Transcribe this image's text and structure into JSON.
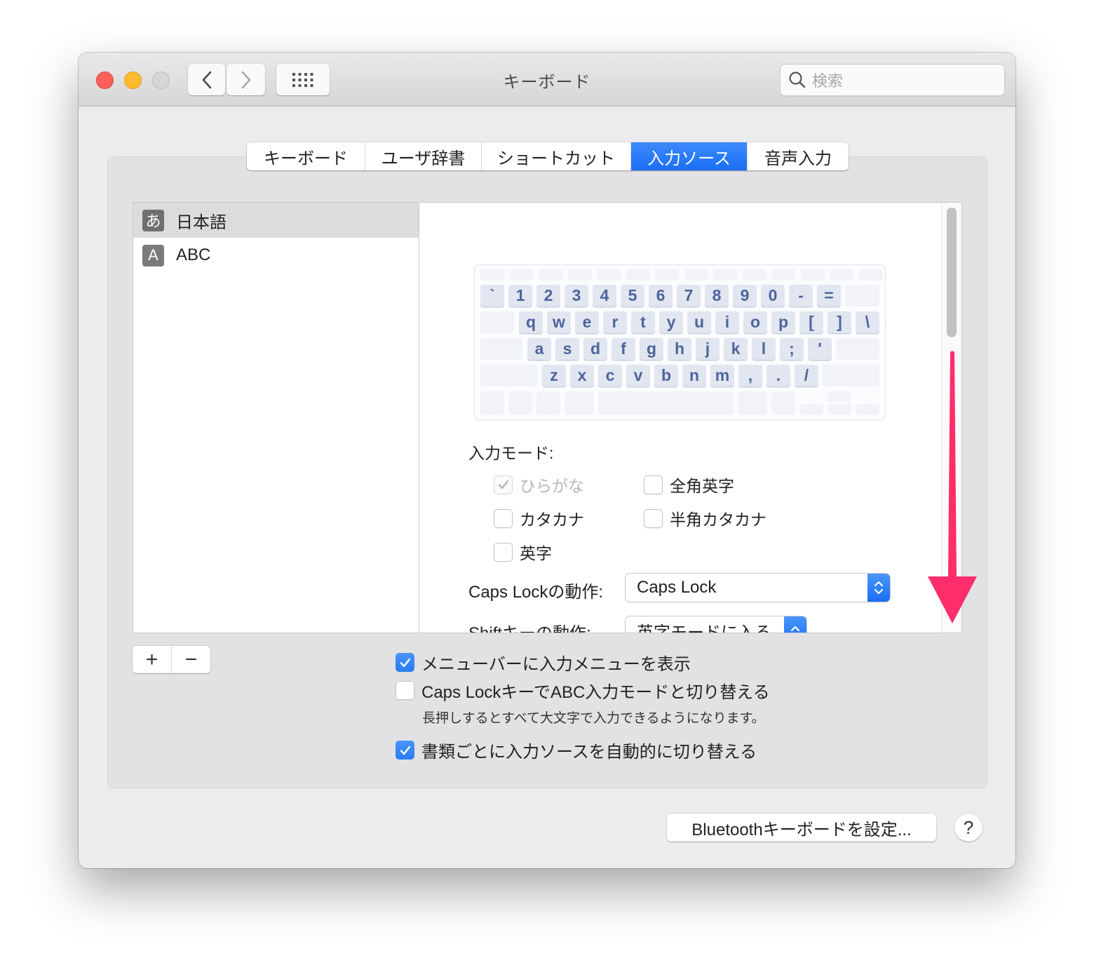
{
  "window": {
    "title": "キーボード",
    "search_placeholder": "検索",
    "traffic_lights": [
      "close",
      "minimize",
      "zoom-disabled"
    ]
  },
  "toolbar": {
    "back_icon": "chevron-left-icon",
    "forward_icon": "chevron-right-icon",
    "show_all_icon": "grid-icon"
  },
  "tabs": [
    {
      "label": "キーボード",
      "active": false
    },
    {
      "label": "ユーザ辞書",
      "active": false
    },
    {
      "label": "ショートカット",
      "active": false
    },
    {
      "label": "入力ソース",
      "active": true
    },
    {
      "label": "音声入力",
      "active": false
    }
  ],
  "sources": [
    {
      "icon_glyph": "あ",
      "label": "日本語",
      "selected": true
    },
    {
      "icon_glyph": "A",
      "label": "ABC",
      "selected": false
    }
  ],
  "keyboard_layout": {
    "row1": [
      "`",
      "1",
      "2",
      "3",
      "4",
      "5",
      "6",
      "7",
      "8",
      "9",
      "0",
      "-",
      "="
    ],
    "row2": [
      "q",
      "w",
      "e",
      "r",
      "t",
      "y",
      "u",
      "i",
      "o",
      "p",
      "[",
      "]",
      "\\"
    ],
    "row3": [
      "a",
      "s",
      "d",
      "f",
      "g",
      "h",
      "j",
      "k",
      "l",
      ";",
      "'"
    ],
    "row4": [
      "z",
      "x",
      "c",
      "v",
      "b",
      "n",
      "m",
      ",",
      ".",
      "/"
    ]
  },
  "input_modes": {
    "label": "入力モード:",
    "options": [
      {
        "label": "ひらがな",
        "checked": true,
        "disabled": true
      },
      {
        "label": "全角英字",
        "checked": false,
        "disabled": false
      },
      {
        "label": "カタカナ",
        "checked": false,
        "disabled": false
      },
      {
        "label": "半角カタカナ",
        "checked": false,
        "disabled": false
      },
      {
        "label": "英字",
        "checked": false,
        "disabled": false
      }
    ]
  },
  "caps_lock_action": {
    "label": "Caps Lockの動作:",
    "value": "Caps Lock"
  },
  "shift_action": {
    "label": "Shiftキーの動作:",
    "value": "英字モードに入る"
  },
  "list_controls": {
    "add_label": "+",
    "remove_label": "−"
  },
  "options": [
    {
      "label": "メニューバーに入力メニューを表示",
      "checked": true
    },
    {
      "label": "Caps LockキーでABC入力モードと切り替える",
      "checked": false,
      "note": "長押しするとすべて大文字で入力できるようになります。"
    },
    {
      "label": "書類ごとに入力ソースを自動的に切り替える",
      "checked": true
    }
  ],
  "footer": {
    "bluetooth_button": "Bluetoothキーボードを設定...",
    "help_label": "?"
  },
  "colors": {
    "accent": "#1a6ef5",
    "annotation_arrow": "#ff2d6b"
  }
}
